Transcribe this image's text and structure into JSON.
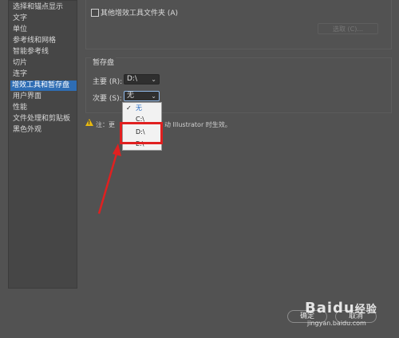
{
  "sidebar": {
    "items": [
      {
        "label": "选择和锚点显示",
        "selected": false
      },
      {
        "label": "文字",
        "selected": false
      },
      {
        "label": "单位",
        "selected": false
      },
      {
        "label": "参考线和网格",
        "selected": false
      },
      {
        "label": "智能参考线",
        "selected": false
      },
      {
        "label": "切片",
        "selected": false
      },
      {
        "label": "连字",
        "selected": false
      },
      {
        "label": "增效工具和暂存盘",
        "selected": true
      },
      {
        "label": "用户界面",
        "selected": false
      },
      {
        "label": "性能",
        "selected": false
      },
      {
        "label": "文件处理和剪贴板",
        "selected": false
      },
      {
        "label": "黑色外观",
        "selected": false
      }
    ]
  },
  "plugins": {
    "checkbox_label": "其他增效工具文件夹 (A)",
    "choose_label": "选取 (C)..."
  },
  "scratch": {
    "title": "暂存盘",
    "primary_label": "主要 (R):",
    "primary_value": "D:\\",
    "secondary_label": "次要 (S):",
    "secondary_value": "无"
  },
  "dropdown": {
    "options": [
      "无",
      "C:\\",
      "D:\\",
      "E:\\"
    ],
    "selected_index": 0
  },
  "note": {
    "text_left": "注：更",
    "text_right": "动 Illustrator 时生效。"
  },
  "footer": {
    "ok_label": "确定",
    "cancel_label": "取消"
  },
  "watermark": {
    "brand": "Baidu",
    "suffix": "经验",
    "url": "jingyan.baidu.com"
  },
  "colors": {
    "highlight": "#e02020",
    "selection": "#2e6db4",
    "warning": "#e8b90f"
  }
}
